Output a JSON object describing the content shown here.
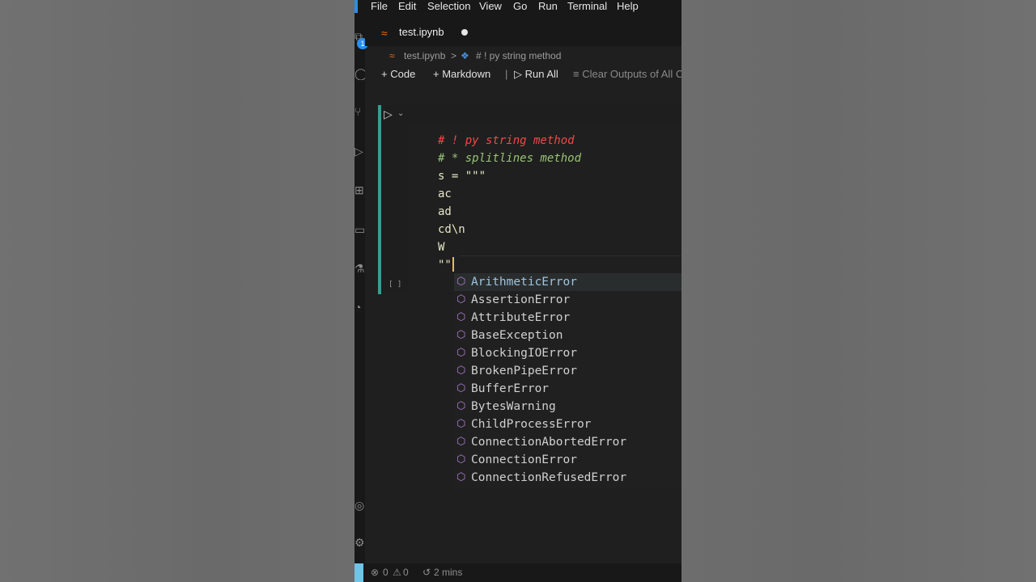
{
  "menu": [
    "File",
    "Edit",
    "Selection",
    "View",
    "Go",
    "Run",
    "Terminal",
    "Help"
  ],
  "tab": {
    "title": "test.ipynb"
  },
  "activity": {
    "badge": "1"
  },
  "breadcrumb": {
    "file": "test.ipynb",
    "sep": ">",
    "cell": "# ! py string method"
  },
  "toolbar": {
    "code": "Code",
    "markdown": "Markdown",
    "run_all": "Run All",
    "clear": "Clear Outputs of All C"
  },
  "editor": {
    "lines": [
      "# ! py string method",
      "# * splitlines method",
      "s = \"\"\"",
      "ac",
      "ad",
      "cd\\n",
      "W",
      "\"\""
    ],
    "exec_count": "[ ]"
  },
  "suggestions": [
    "ArithmeticError",
    "AssertionError",
    "AttributeError",
    "BaseException",
    "BlockingIOError",
    "BrokenPipeError",
    "BufferError",
    "BytesWarning",
    "ChildProcessError",
    "ConnectionAbortedError",
    "ConnectionError",
    "ConnectionRefusedError"
  ],
  "status": {
    "errors": "0",
    "warnings": "0",
    "time": "2 mins"
  },
  "colors": {
    "accent": "#2f8ce8",
    "cell_indicator": "#3a9c93",
    "comment_red": "#f44747",
    "comment_green": "#98c379"
  }
}
